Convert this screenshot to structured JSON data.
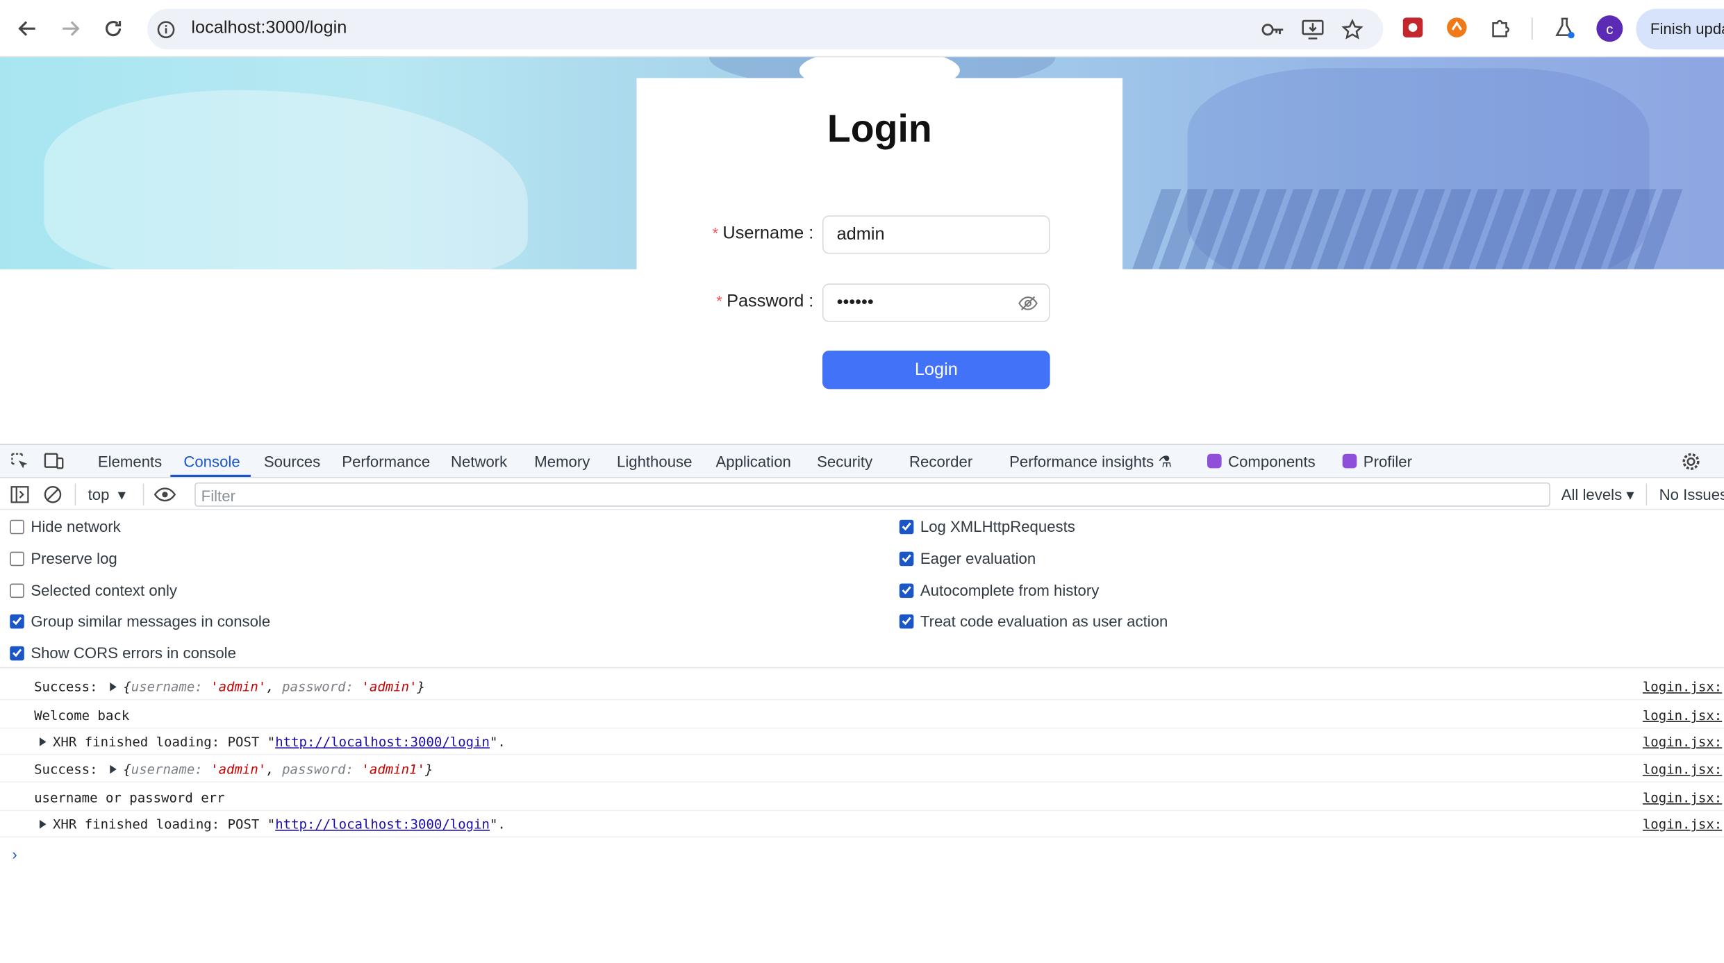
{
  "browser": {
    "url": "localhost:3000/login",
    "avatar_letter": "c",
    "finish_update_label": "Finish upda"
  },
  "page": {
    "title": "Login",
    "username_label": "Username",
    "username_value": "admin",
    "password_label": "Password",
    "password_value": "••••••",
    "login_button": "Login"
  },
  "devtools": {
    "tabs": [
      "Elements",
      "Console",
      "Sources",
      "Performance",
      "Network",
      "Memory",
      "Lighthouse",
      "Application",
      "Security",
      "Recorder",
      "Performance insights",
      "Components",
      "Profiler"
    ],
    "active_tab": "Console",
    "context": "top",
    "filter_placeholder": "Filter",
    "levels": "All levels",
    "issues": "No Issues",
    "settings_left": [
      {
        "label": "Hide network",
        "checked": false
      },
      {
        "label": "Preserve log",
        "checked": false
      },
      {
        "label": "Selected context only",
        "checked": false
      },
      {
        "label": "Group similar messages in console",
        "checked": true
      },
      {
        "label": "Show CORS errors in console",
        "checked": true
      }
    ],
    "settings_right": [
      {
        "label": "Log XMLHttpRequests",
        "checked": true
      },
      {
        "label": "Eager evaluation",
        "checked": true
      },
      {
        "label": "Autocomplete from history",
        "checked": true
      },
      {
        "label": "Treat code evaluation as user action",
        "checked": true
      }
    ],
    "console": {
      "success_prefix": "Success:",
      "username_key": "username",
      "password_key": "password",
      "row1_username": "'admin'",
      "row1_password": "'admin'",
      "row2_text": "Welcome back",
      "xhr_prefix": "XHR finished loading: POST \"",
      "xhr_url": "http://localhost:3000/login",
      "xhr_suffix": "\".",
      "row4_username": "'admin'",
      "row4_password": "'admin1'",
      "row5_text": "username or password err",
      "source": "login.jsx:"
    }
  },
  "colors": {
    "primary_button": "#4272f7",
    "devtools_accent": "#1a56c6",
    "required_asterisk": "#ff4d4f"
  }
}
